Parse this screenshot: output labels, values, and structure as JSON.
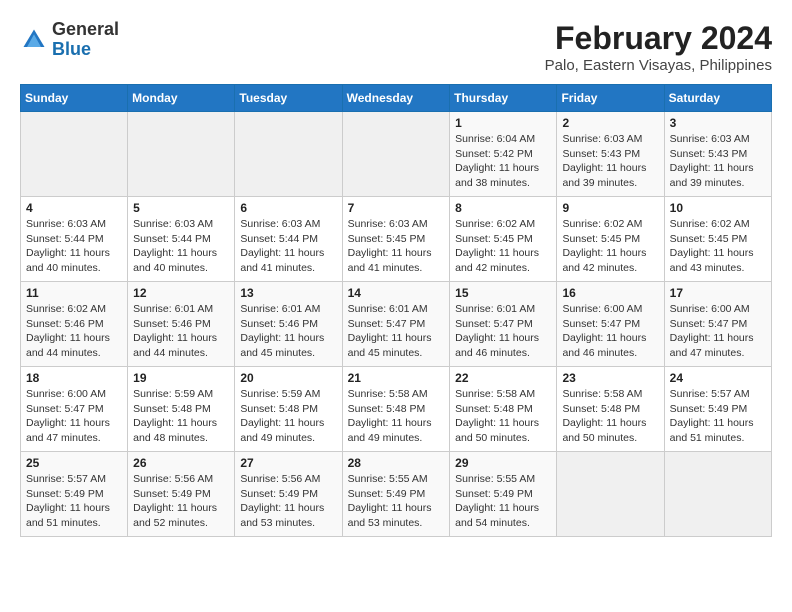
{
  "header": {
    "logo_general": "General",
    "logo_blue": "Blue",
    "month_year": "February 2024",
    "location": "Palo, Eastern Visayas, Philippines"
  },
  "weekdays": [
    "Sunday",
    "Monday",
    "Tuesday",
    "Wednesday",
    "Thursday",
    "Friday",
    "Saturday"
  ],
  "weeks": [
    [
      {
        "day": "",
        "info": ""
      },
      {
        "day": "",
        "info": ""
      },
      {
        "day": "",
        "info": ""
      },
      {
        "day": "",
        "info": ""
      },
      {
        "day": "1",
        "info": "Sunrise: 6:04 AM\nSunset: 5:42 PM\nDaylight: 11 hours and 38 minutes."
      },
      {
        "day": "2",
        "info": "Sunrise: 6:03 AM\nSunset: 5:43 PM\nDaylight: 11 hours and 39 minutes."
      },
      {
        "day": "3",
        "info": "Sunrise: 6:03 AM\nSunset: 5:43 PM\nDaylight: 11 hours and 39 minutes."
      }
    ],
    [
      {
        "day": "4",
        "info": "Sunrise: 6:03 AM\nSunset: 5:44 PM\nDaylight: 11 hours and 40 minutes."
      },
      {
        "day": "5",
        "info": "Sunrise: 6:03 AM\nSunset: 5:44 PM\nDaylight: 11 hours and 40 minutes."
      },
      {
        "day": "6",
        "info": "Sunrise: 6:03 AM\nSunset: 5:44 PM\nDaylight: 11 hours and 41 minutes."
      },
      {
        "day": "7",
        "info": "Sunrise: 6:03 AM\nSunset: 5:45 PM\nDaylight: 11 hours and 41 minutes."
      },
      {
        "day": "8",
        "info": "Sunrise: 6:02 AM\nSunset: 5:45 PM\nDaylight: 11 hours and 42 minutes."
      },
      {
        "day": "9",
        "info": "Sunrise: 6:02 AM\nSunset: 5:45 PM\nDaylight: 11 hours and 42 minutes."
      },
      {
        "day": "10",
        "info": "Sunrise: 6:02 AM\nSunset: 5:45 PM\nDaylight: 11 hours and 43 minutes."
      }
    ],
    [
      {
        "day": "11",
        "info": "Sunrise: 6:02 AM\nSunset: 5:46 PM\nDaylight: 11 hours and 44 minutes."
      },
      {
        "day": "12",
        "info": "Sunrise: 6:01 AM\nSunset: 5:46 PM\nDaylight: 11 hours and 44 minutes."
      },
      {
        "day": "13",
        "info": "Sunrise: 6:01 AM\nSunset: 5:46 PM\nDaylight: 11 hours and 45 minutes."
      },
      {
        "day": "14",
        "info": "Sunrise: 6:01 AM\nSunset: 5:47 PM\nDaylight: 11 hours and 45 minutes."
      },
      {
        "day": "15",
        "info": "Sunrise: 6:01 AM\nSunset: 5:47 PM\nDaylight: 11 hours and 46 minutes."
      },
      {
        "day": "16",
        "info": "Sunrise: 6:00 AM\nSunset: 5:47 PM\nDaylight: 11 hours and 46 minutes."
      },
      {
        "day": "17",
        "info": "Sunrise: 6:00 AM\nSunset: 5:47 PM\nDaylight: 11 hours and 47 minutes."
      }
    ],
    [
      {
        "day": "18",
        "info": "Sunrise: 6:00 AM\nSunset: 5:47 PM\nDaylight: 11 hours and 47 minutes."
      },
      {
        "day": "19",
        "info": "Sunrise: 5:59 AM\nSunset: 5:48 PM\nDaylight: 11 hours and 48 minutes."
      },
      {
        "day": "20",
        "info": "Sunrise: 5:59 AM\nSunset: 5:48 PM\nDaylight: 11 hours and 49 minutes."
      },
      {
        "day": "21",
        "info": "Sunrise: 5:58 AM\nSunset: 5:48 PM\nDaylight: 11 hours and 49 minutes."
      },
      {
        "day": "22",
        "info": "Sunrise: 5:58 AM\nSunset: 5:48 PM\nDaylight: 11 hours and 50 minutes."
      },
      {
        "day": "23",
        "info": "Sunrise: 5:58 AM\nSunset: 5:48 PM\nDaylight: 11 hours and 50 minutes."
      },
      {
        "day": "24",
        "info": "Sunrise: 5:57 AM\nSunset: 5:49 PM\nDaylight: 11 hours and 51 minutes."
      }
    ],
    [
      {
        "day": "25",
        "info": "Sunrise: 5:57 AM\nSunset: 5:49 PM\nDaylight: 11 hours and 51 minutes."
      },
      {
        "day": "26",
        "info": "Sunrise: 5:56 AM\nSunset: 5:49 PM\nDaylight: 11 hours and 52 minutes."
      },
      {
        "day": "27",
        "info": "Sunrise: 5:56 AM\nSunset: 5:49 PM\nDaylight: 11 hours and 53 minutes."
      },
      {
        "day": "28",
        "info": "Sunrise: 5:55 AM\nSunset: 5:49 PM\nDaylight: 11 hours and 53 minutes."
      },
      {
        "day": "29",
        "info": "Sunrise: 5:55 AM\nSunset: 5:49 PM\nDaylight: 11 hours and 54 minutes."
      },
      {
        "day": "",
        "info": ""
      },
      {
        "day": "",
        "info": ""
      }
    ]
  ]
}
